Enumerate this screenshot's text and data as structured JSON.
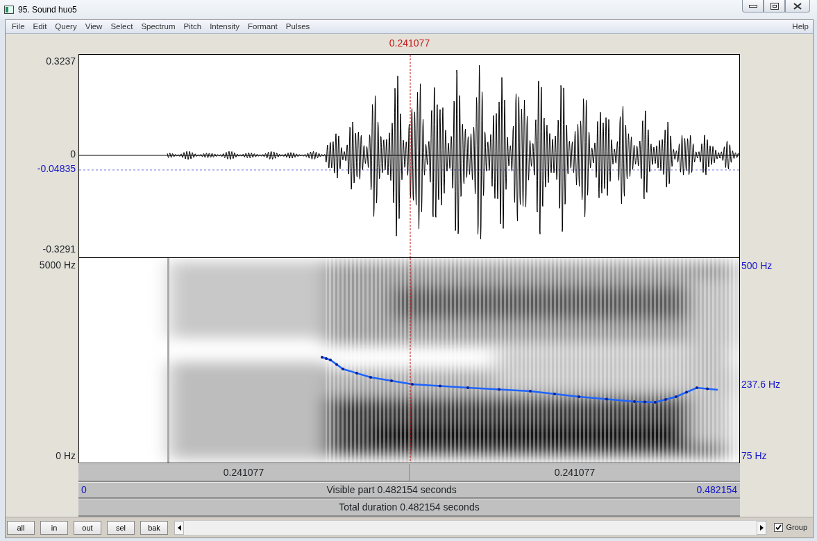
{
  "window": {
    "title": "95. Sound huo5"
  },
  "menu": {
    "items": [
      "File",
      "Edit",
      "Query",
      "View",
      "Select",
      "Spectrum",
      "Pitch",
      "Intensity",
      "Formant",
      "Pulses"
    ],
    "help": "Help"
  },
  "cursor_time": "0.241077",
  "waveform": {
    "y_max": "0.3237",
    "zero": "0",
    "zero_level": "-0.04835",
    "y_min": "-0.3291"
  },
  "spectrogram": {
    "freq_max": "5000 Hz",
    "freq_min": "0 Hz"
  },
  "pitch": {
    "max": "500 Hz",
    "value": "237.6 Hz",
    "min": "75 Hz"
  },
  "selection_bar": [
    "0.241077",
    "0.241077"
  ],
  "visible_bar": {
    "start": "0",
    "label": "Visible part 0.482154 seconds",
    "end": "0.482154"
  },
  "total_bar": {
    "label": "Total duration 0.482154 seconds"
  },
  "buttons": [
    "all",
    "in",
    "out",
    "sel",
    "bak"
  ],
  "group": {
    "label": "Group",
    "checked": true
  }
}
